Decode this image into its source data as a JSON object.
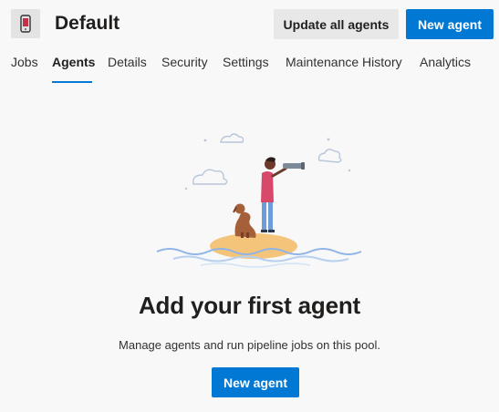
{
  "header": {
    "title": "Default",
    "update_all_label": "Update all agents",
    "new_agent_label": "New agent"
  },
  "tabs": [
    {
      "label": "Jobs"
    },
    {
      "label": "Agents"
    },
    {
      "label": "Details"
    },
    {
      "label": "Security"
    },
    {
      "label": "Settings"
    },
    {
      "label": "Maintenance History"
    },
    {
      "label": "Analytics"
    }
  ],
  "active_tab": "Agents",
  "empty_state": {
    "title": "Add your first agent",
    "description": "Manage agents and run pipeline jobs on this pool.",
    "cta_label": "New agent"
  },
  "colors": {
    "accent": "#0078d4",
    "background": "#f8f8f8"
  },
  "icons": {
    "pool": "phone-icon"
  }
}
